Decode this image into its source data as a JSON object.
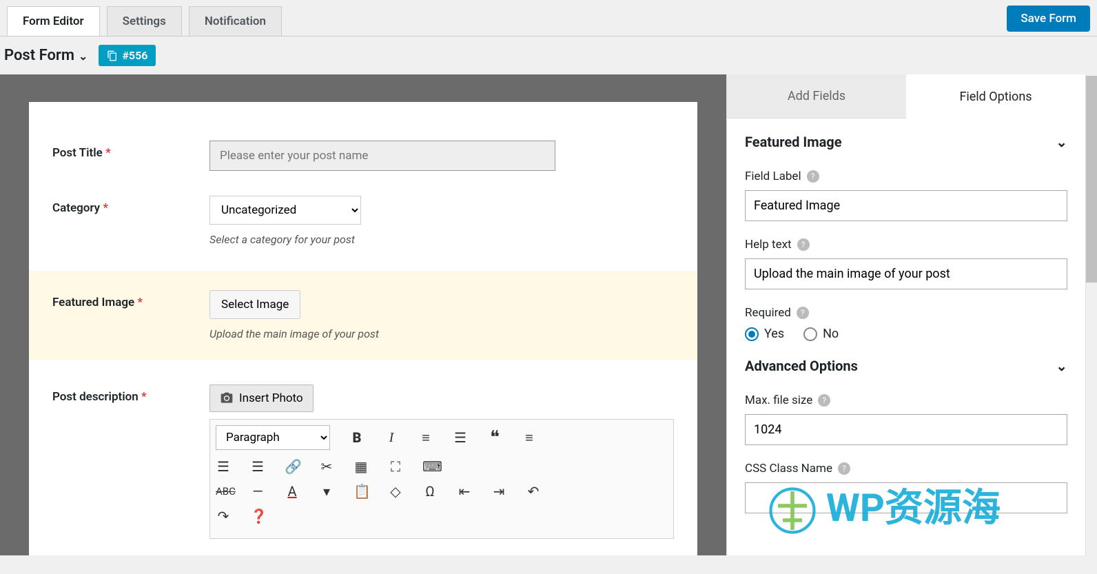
{
  "topTabs": {
    "formEditor": "Form Editor",
    "settings": "Settings",
    "notification": "Notification"
  },
  "saveBtn": "Save Form",
  "formTitle": "Post Form",
  "formId": "#556",
  "fields": {
    "postTitle": {
      "label": "Post Title",
      "placeholder": "Please enter your post name"
    },
    "category": {
      "label": "Category",
      "value": "Uncategorized",
      "hint": "Select a category for your post"
    },
    "featured": {
      "label": "Featured Image",
      "button": "Select Image",
      "hint": "Upload the main image of your post"
    },
    "postDesc": {
      "label": "Post description",
      "insertPhoto": "Insert Photo",
      "paragraph": "Paragraph"
    }
  },
  "sideTabs": {
    "add": "Add Fields",
    "options": "Field Options"
  },
  "sidebar": {
    "sectionTitle": "Featured Image",
    "fieldLabel": {
      "lbl": "Field Label",
      "val": "Featured Image"
    },
    "helpText": {
      "lbl": "Help text",
      "val": "Upload the main image of your post"
    },
    "required": {
      "lbl": "Required",
      "yes": "Yes",
      "no": "No"
    },
    "advanced": "Advanced Options",
    "maxFile": {
      "lbl": "Max. file size",
      "val": "1024"
    },
    "cssClass": {
      "lbl": "CSS Class Name"
    }
  },
  "watermark": "WP资源海"
}
